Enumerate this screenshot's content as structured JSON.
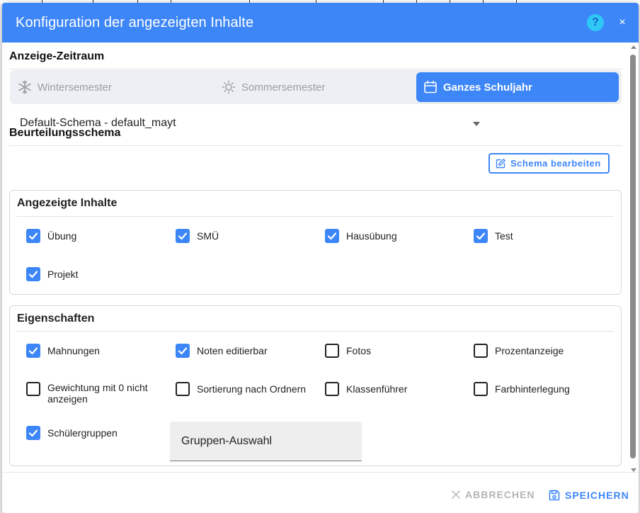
{
  "dialog": {
    "title": "Konfiguration der angezeigten Inhalte",
    "help_label": "?",
    "close_label": "×"
  },
  "period": {
    "title": "Anzeige-Zeitraum",
    "options": [
      {
        "label": "Wintersemester",
        "icon": "snowflake-icon",
        "active": false
      },
      {
        "label": "Sommersemester",
        "icon": "sun-icon",
        "active": false
      },
      {
        "label": "Ganzes Schuljahr",
        "icon": "calendar-icon",
        "active": true
      }
    ]
  },
  "schema": {
    "title": "Beurteilungsschema",
    "selected": "Default-Schema - default_mayt",
    "edit_label": "Schema bearbeiten"
  },
  "content": {
    "title": "Angezeigte Inhalte",
    "items": [
      {
        "label": "Übung",
        "checked": true
      },
      {
        "label": "SMÜ",
        "checked": true
      },
      {
        "label": "Hausübung",
        "checked": true
      },
      {
        "label": "Test",
        "checked": true
      },
      {
        "label": "Projekt",
        "checked": true
      }
    ]
  },
  "properties": {
    "title": "Eigenschaften",
    "items": [
      {
        "label": "Mahnungen",
        "checked": true
      },
      {
        "label": "Noten editierbar",
        "checked": true
      },
      {
        "label": "Fotos",
        "checked": false
      },
      {
        "label": "Prozentanzeige",
        "checked": false
      },
      {
        "label": "Gewichtung mit 0 nicht anzeigen",
        "checked": false
      },
      {
        "label": "Sortierung nach Ordnern",
        "checked": false
      },
      {
        "label": "Klassenführer",
        "checked": false
      },
      {
        "label": "Farbhinterlegung",
        "checked": false
      },
      {
        "label": "Schülergruppen",
        "checked": true
      }
    ],
    "group_select_label": "Gruppen-Auswahl"
  },
  "footer": {
    "cancel_label": "ABBRECHEN",
    "save_label": "SPEICHERN"
  },
  "colors": {
    "primary": "#3d86f7",
    "help": "#2ec8f5",
    "disabled": "#b5b5b5"
  }
}
